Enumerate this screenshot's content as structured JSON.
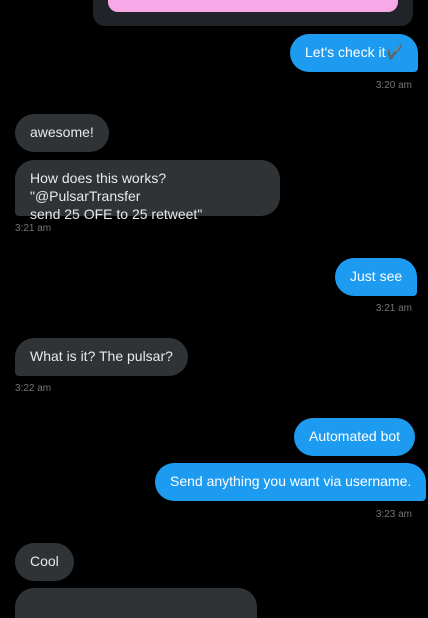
{
  "messages": [
    {
      "text": "Let's check it✔️"
    },
    {
      "text": "awesome!"
    },
    {
      "line1": "How does this works? \"@PulsarTransfer",
      "line2": "send 25 OFE to 25 retweet\""
    },
    {
      "text": "Just see"
    },
    {
      "text": "What is it? The pulsar?"
    },
    {
      "text": "Automated bot"
    },
    {
      "text": "Send anything you want via username."
    },
    {
      "text": "Cool"
    }
  ],
  "timestamps": [
    "3:20 am",
    "3:21 am",
    "3:21 am",
    "3:22 am",
    "3:23 am"
  ],
  "colors": {
    "background": "#000000",
    "sent_bubble": "#1d9bf0",
    "received_bubble": "#2f3336",
    "timestamp": "#71767b",
    "card_image": "#f7a8e6"
  }
}
